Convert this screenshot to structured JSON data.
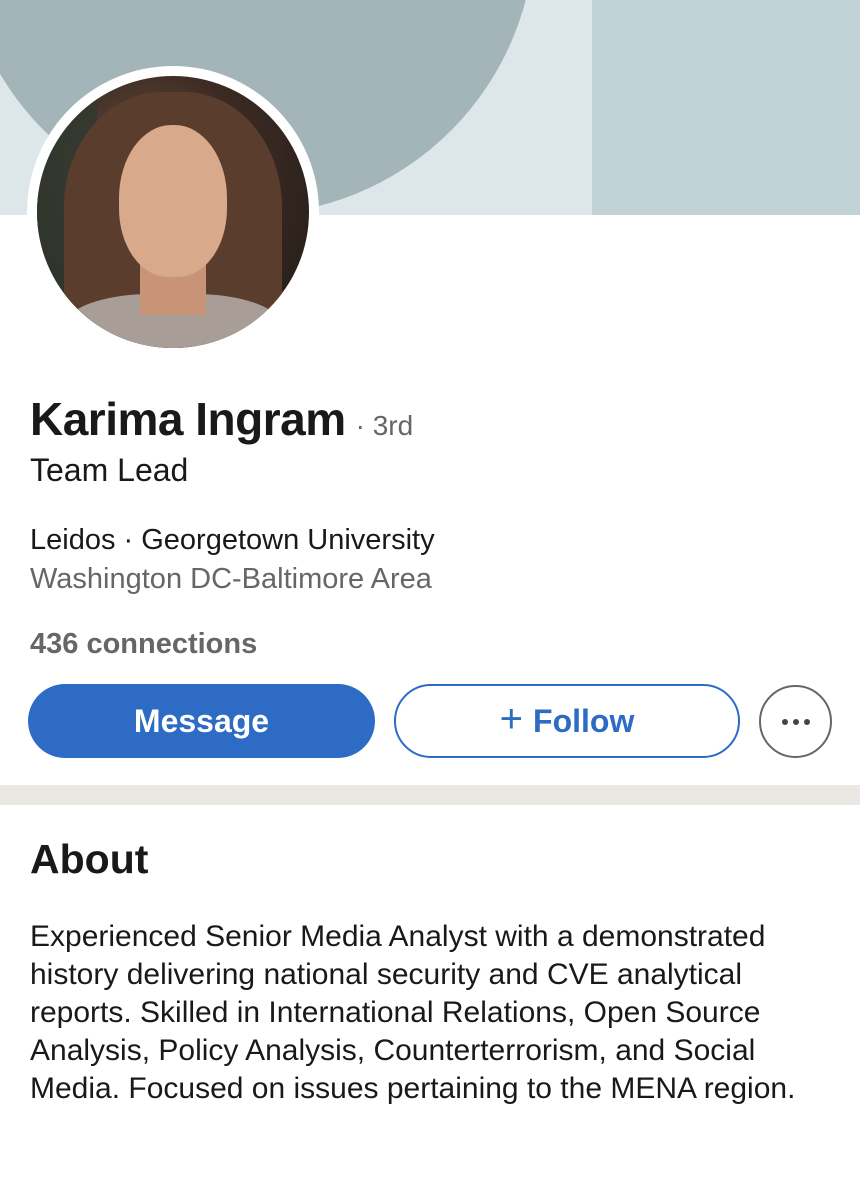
{
  "profile": {
    "name": "Karima Ingram",
    "degree": "· 3rd",
    "headline": "Team Lead",
    "company_school": "Leidos · Georgetown University",
    "location": "Washington DC-Baltimore Area",
    "connections": "436 connections"
  },
  "actions": {
    "message_label": "Message",
    "follow_plus": "+",
    "follow_label": "Follow",
    "more_icon": "more-horizontal-icon"
  },
  "about": {
    "title": "About",
    "text": "Experienced Senior Media Analyst with a demonstrated history delivering national security and CVE analytical reports. Skilled in International Relations, Open Source Analysis, Policy Analysis, Counterterrorism, and Social Media. Focused on issues pertaining to the MENA region."
  },
  "colors": {
    "accent": "#2d6bc4",
    "cover_dark": "#a4b5ba",
    "cover_light": "#dde6e9",
    "cover_mid": "#c2d3d8",
    "secondary_text": "#666666",
    "divider": "#ebe8e3"
  }
}
